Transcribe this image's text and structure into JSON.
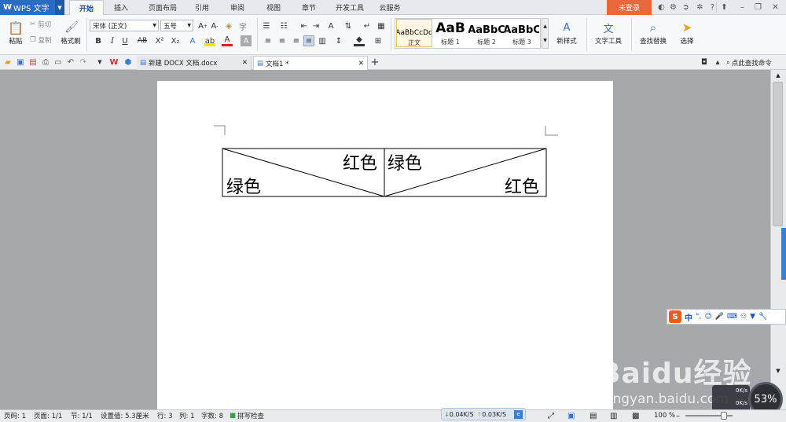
{
  "app": {
    "name": "WPS 文字",
    "login_label": "未登录"
  },
  "menu_tabs": [
    "开始",
    "插入",
    "页面布局",
    "引用",
    "审阅",
    "视图",
    "章节",
    "开发工具",
    "云服务"
  ],
  "ribbon": {
    "paste": "粘贴",
    "cut": "剪切",
    "copy": "复制",
    "format_painter": "格式刷",
    "font_name": "宋体 (正文)",
    "font_size": "五号",
    "styles": [
      {
        "preview": "AaBbCcDd",
        "name": "正文"
      },
      {
        "preview": "AaB",
        "name": "标题 1"
      },
      {
        "preview": "AaBbC",
        "name": "标题 2"
      },
      {
        "preview": "AaBbC",
        "name": "标题 3"
      }
    ],
    "new_style": "新样式",
    "text_tools": "文字工具",
    "find_replace": "查找替换",
    "select": "选择"
  },
  "doc_tabs": [
    {
      "label": "新建 DOCX 文档.docx",
      "active": false
    },
    {
      "label": "文档1 *",
      "active": true
    }
  ],
  "find_command": "点此查找命令",
  "table": {
    "cell1_top": "红色",
    "cell1_bottom": "绿色",
    "cell2_top": "绿色",
    "cell2_bottom": "红色"
  },
  "status": {
    "page": "页码: 1",
    "pages": "页面: 1/1",
    "section": "节: 1/1",
    "setting": "设置值: 5.3厘米",
    "line": "行: 3",
    "col": "列: 1",
    "words": "字数: 8",
    "spell": "拼写检查",
    "zoom": "100 %"
  },
  "network": {
    "down": "0.04K/S",
    "up": "0.03K/S",
    "percent": "53%",
    "down_small": "0K/s",
    "up_small": "0K/s"
  },
  "watermark": {
    "brand": "Baidu经验",
    "url": "jingyan.baidu.com"
  }
}
